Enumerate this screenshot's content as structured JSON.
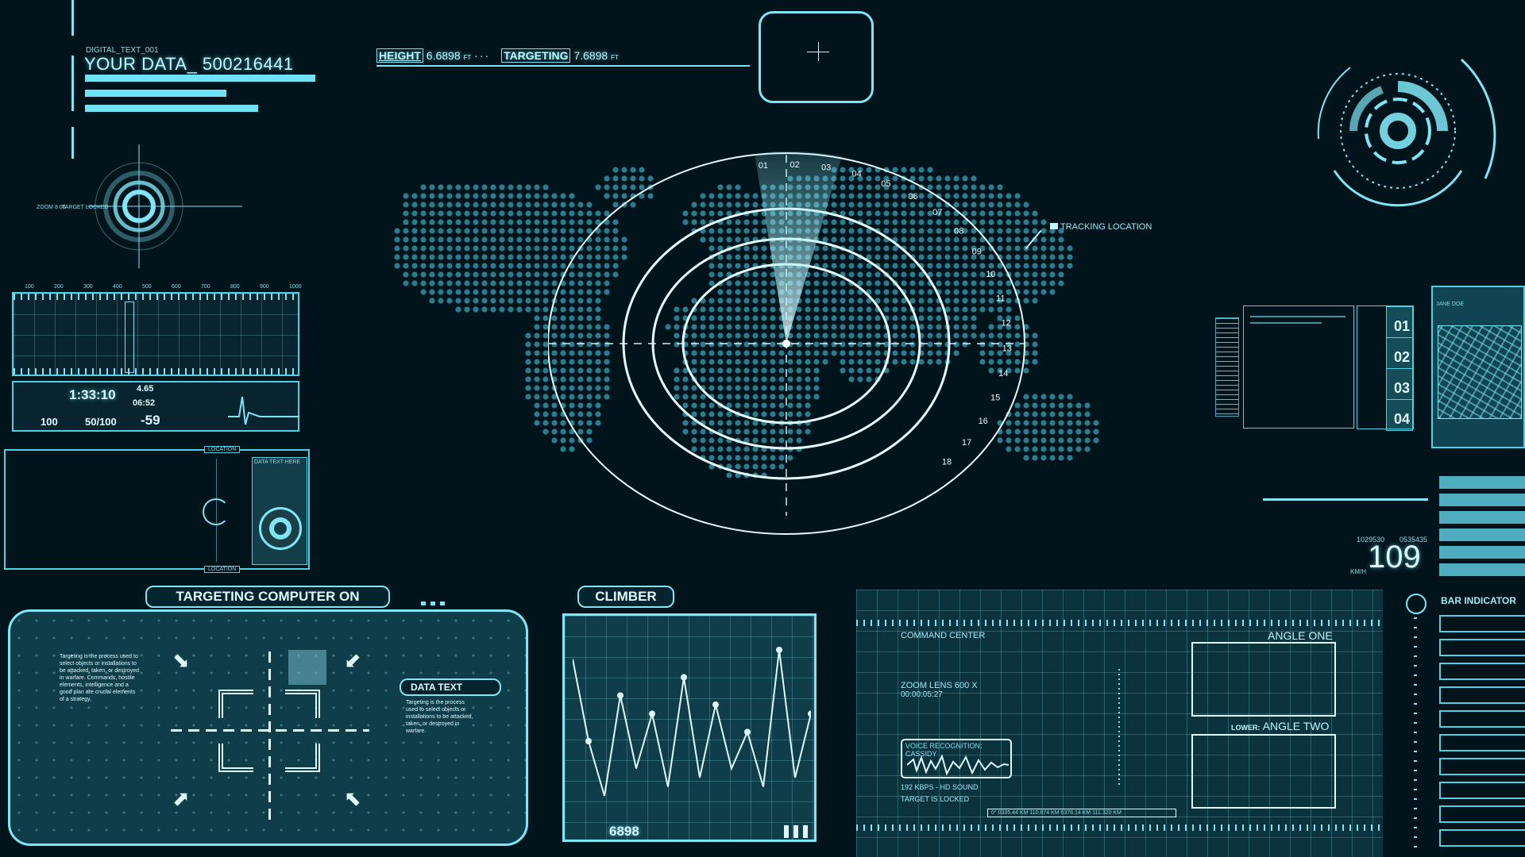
{
  "header": {
    "digital_text": "DIGITAL_TEXT_001",
    "your_data": "YOUR DATA_ 500216441",
    "height_label": "HEIGHT",
    "height_value": "6.6898",
    "height_unit": "FT",
    "targeting_label": "TARGETING",
    "targeting_value": "7.6898",
    "targeting_unit": "FT"
  },
  "target_reticle": {
    "zoom_text": "ZOOM 8.00",
    "status": "TARGET LOCKED"
  },
  "radar": {
    "tick_labels": [
      "01",
      "02",
      "03",
      "04",
      "05",
      "06",
      "07",
      "08",
      "09",
      "10",
      "11",
      "12",
      "13",
      "14",
      "15",
      "16",
      "17",
      "18"
    ],
    "tracking_label": "TRACKING LOCATION"
  },
  "monitor": {
    "ruler_labels": [
      "100",
      "200",
      "300",
      "400",
      "500",
      "600",
      "700",
      "800",
      "900",
      "1000"
    ],
    "time": "1:33:10",
    "value_a": "4.65",
    "value_b": "06:52",
    "value_c": "100",
    "value_d": "50/100",
    "value_e": "-59"
  },
  "location_panel": {
    "top_label": "LOCATION",
    "bottom_label": "LOCATION",
    "side_title": "DATA TEXT HERE"
  },
  "targeting_panel": {
    "title": "TARGETING COMPUTER ON",
    "body_text": "Targeting is the process used to select objects or installations to be attacked, taken, or destroyed in warfare. Commands, hostile elements, intelligence and a good plan are crucial elements of a strategy.",
    "data_text_label": "DATA TEXT",
    "data_text_body": "Targeting is the process used to select objects or installations to be attacked, taken, or destroyed in warfare."
  },
  "climber": {
    "title": "CLIMBER",
    "value": "6898",
    "line_points": [
      0.15,
      0.6,
      0.9,
      0.35,
      0.75,
      0.45,
      0.85,
      0.25,
      0.8,
      0.4,
      0.75,
      0.55,
      0.85,
      0.1,
      0.8,
      0.45
    ]
  },
  "command_center": {
    "title": "COMMAND CENTER",
    "zoom": "ZOOM LENS 600 X",
    "time": "00:00:05:27",
    "voice_label": "VOICE RECOGNITION: CASSIDY",
    "audio": "192 KBPS - HD SOUND",
    "status": "TARGET IS LOCKED",
    "angle_one": "ANGLE ONE",
    "lower_label": "LOWER:",
    "angle_two": "ANGLE TWO",
    "coords": "0°  0335.44 KM   110.874 KM    6378.14 KM   111.320 KM"
  },
  "right_side": {
    "list_numbers": [
      "01",
      "02",
      "03",
      "04"
    ],
    "speed_unit": "KM/H",
    "speed_value": "109",
    "code_a": "1029530",
    "code_b": "0535435",
    "bar_indicator": "BAR INDICATOR",
    "map_title": "JANE DOE"
  },
  "theme": {
    "background": "#02141b",
    "accent": "#7fe6f5",
    "bright": "#dffaff"
  }
}
